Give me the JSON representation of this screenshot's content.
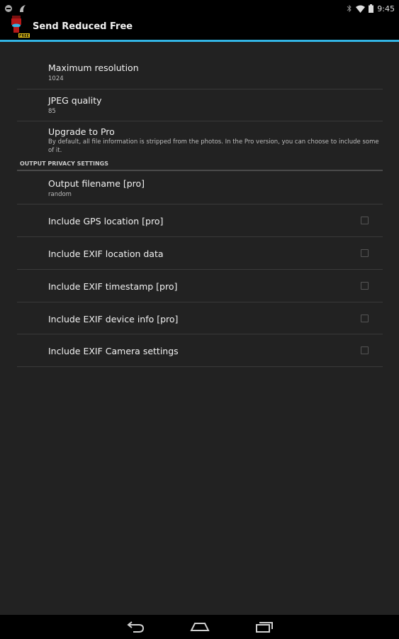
{
  "status_bar": {
    "time": "9:45",
    "left_icons": [
      "android-debug-icon",
      "notification-icon"
    ],
    "right_icons": [
      "bluetooth-icon",
      "wifi-icon",
      "battery-icon"
    ]
  },
  "action_bar": {
    "title": "Send Reduced Free",
    "app_icon_badge": "FREE"
  },
  "preferences": {
    "max_resolution": {
      "title": "Maximum resolution",
      "summary": "1024"
    },
    "jpeg_quality": {
      "title": "JPEG quality",
      "summary": "85"
    },
    "upgrade": {
      "title": "Upgrade to Pro",
      "summary": "By default, all file information is stripped from the photos. In the Pro version, you can choose to include some of it."
    },
    "category_title": "OUTPUT PRIVACY SETTINGS",
    "output_filename": {
      "title": "Output filename [pro]",
      "summary": "random"
    },
    "gps_location": {
      "title": "Include GPS location [pro]",
      "checked": false
    },
    "exif_location": {
      "title": "Include EXIF location data",
      "checked": false
    },
    "exif_timestamp": {
      "title": "Include EXIF timestamp [pro]",
      "checked": false
    },
    "exif_device": {
      "title": "Include EXIF device info [pro]",
      "checked": false
    },
    "exif_camera": {
      "title": "Include EXIF Camera settings",
      "checked": false
    }
  },
  "nav_bar": {
    "buttons": [
      "back-icon",
      "home-icon",
      "recent-apps-icon"
    ]
  },
  "colors": {
    "accent": "#33b5e5",
    "background": "#222222",
    "bar": "#000000"
  }
}
